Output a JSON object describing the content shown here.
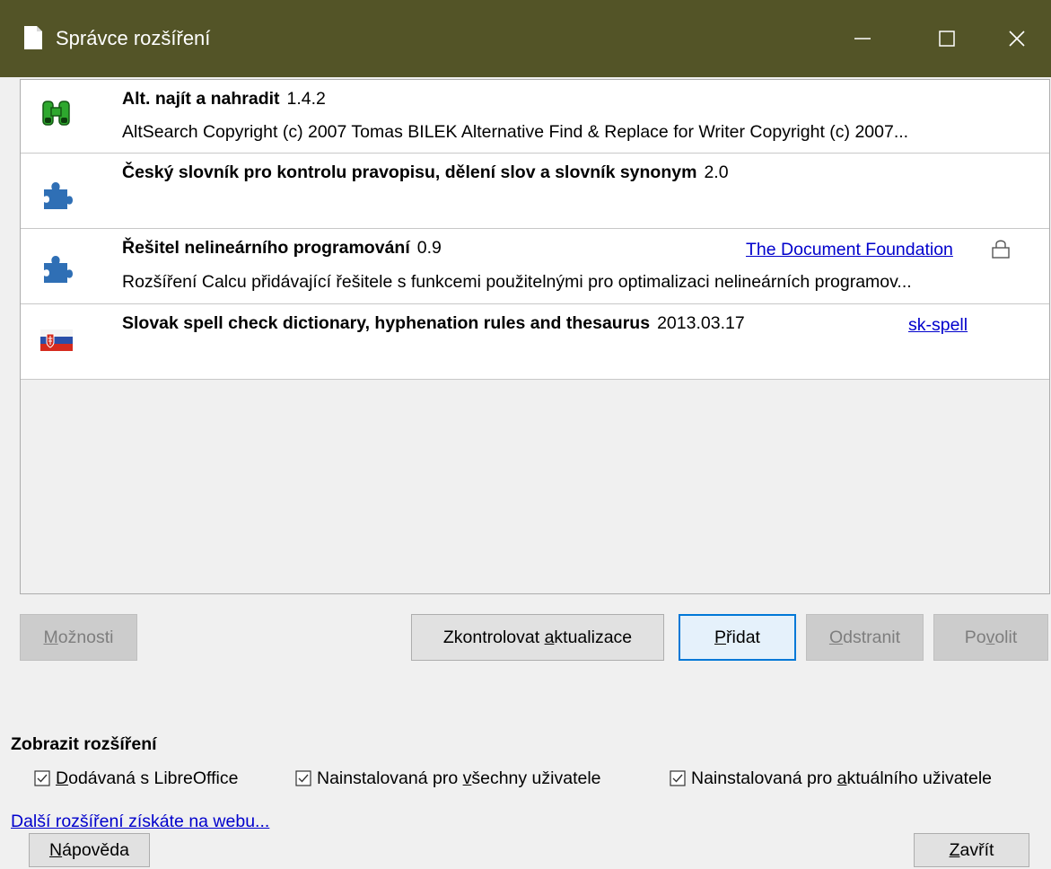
{
  "window": {
    "title": "Správce rozšíření"
  },
  "extensions": [
    {
      "name": "Alt. najít a nahradit",
      "version": "1.4.2",
      "description": "AltSearch  Copyright (c) 2007 Tomas BILEK  Alternative Find & Replace for Writer  Copyright (c) 2007...",
      "publisher": "",
      "icon": "binoculars-icon"
    },
    {
      "name": "Český slovník pro kontrolu pravopisu, dělení slov a slovník synonym",
      "version": "2.0",
      "description": "",
      "publisher": "",
      "icon": "puzzle-icon"
    },
    {
      "name": "Řešitel nelineárního programování",
      "version": "0.9",
      "description": "Rozšíření Calcu přidávající řešitele s funkcemi použitelnými pro optimalizaci nelineárních programov...",
      "publisher": "The Document Foundation",
      "icon": "puzzle-icon",
      "locked": true
    },
    {
      "name": "Slovak spell check dictionary, hyphenation rules and thesaurus",
      "version": "2013.03.17",
      "description": "",
      "publisher": "sk-spell",
      "icon": "slovak-flag-icon"
    }
  ],
  "buttons": {
    "options": {
      "pre": "",
      "key": "M",
      "post": "ožnosti"
    },
    "check_updates": {
      "pre": "Zkontrolovat ",
      "key": "a",
      "post": "ktualizace"
    },
    "add": {
      "pre": "",
      "key": "P",
      "post": "řidat"
    },
    "remove": {
      "pre": "",
      "key": "O",
      "post": "dstranit"
    },
    "enable": {
      "pre": "Po",
      "key": "v",
      "post": "olit"
    },
    "help": {
      "pre": "",
      "key": "N",
      "post": "ápověda"
    },
    "close": {
      "pre": "",
      "key": "Z",
      "post": "avřít"
    }
  },
  "show_extensions": {
    "title": "Zobrazit rozšíření",
    "bundled": {
      "pre": "",
      "key": "D",
      "post": "odávaná s LibreOffice",
      "checked": true
    },
    "shared": {
      "pre": "Nainstalovaná pro ",
      "key": "v",
      "post": "šechny uživatele",
      "checked": true
    },
    "user": {
      "pre": "Nainstalovaná pro ",
      "key": "a",
      "post": "ktuálního uživatele",
      "checked": true
    }
  },
  "web_link": "Další rozšíření získáte na webu...",
  "colors": {
    "titlebar": "#535427",
    "link": "#0000cc",
    "accent": "#0078d7"
  }
}
